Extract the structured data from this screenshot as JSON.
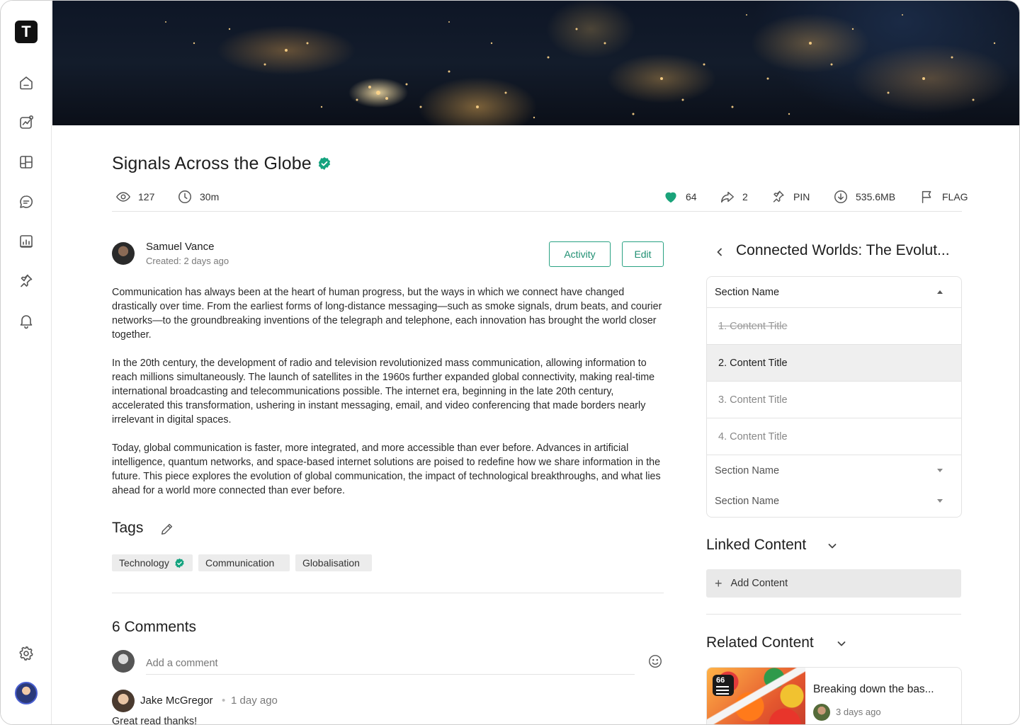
{
  "app": {
    "logo_letter": "T"
  },
  "sidebar": {
    "items": [
      {
        "icon": "home-icon"
      },
      {
        "icon": "analytics-icon"
      },
      {
        "icon": "layout-icon"
      },
      {
        "icon": "chat-icon"
      },
      {
        "icon": "report-icon"
      },
      {
        "icon": "pin-icon"
      },
      {
        "icon": "bell-icon"
      }
    ],
    "settings_icon": "gear-icon"
  },
  "article": {
    "title": "Signals Across the Globe",
    "stats": {
      "views": "127",
      "duration": "30m",
      "likes": "64",
      "shares": "2",
      "pin_label": "PIN",
      "size": "535.6MB",
      "flag_label": "FLAG"
    },
    "author": {
      "name": "Samuel Vance",
      "created": "Created: 2 days ago"
    },
    "buttons": {
      "activity": "Activity",
      "edit": "Edit"
    },
    "paragraphs": [
      "Communication has always been at the heart of human progress, but the ways in which we connect have changed drastically over time. From the earliest forms of long-distance messaging—such as smoke signals, drum beats, and courier networks—to the groundbreaking inventions of the telegraph and telephone, each innovation has brought the world closer together.",
      "In the 20th century, the development of radio and television revolutionized mass communication, allowing information to reach millions simultaneously. The launch of satellites in the 1960s further expanded global connectivity, making real-time international broadcasting and telecommunications possible. The internet era, beginning in the late 20th century, accelerated this transformation, ushering in instant messaging, email, and video conferencing that made borders nearly irrelevant in digital spaces.",
      "Today, global communication is faster, more integrated, and more accessible than ever before. Advances in artificial intelligence, quantum networks, and space-based internet solutions are poised to redefine how we share information in the future. This piece explores the evolution of global communication, the impact of technological breakthroughs, and what lies ahead for a world more connected than ever before."
    ],
    "tags_title": "Tags",
    "tags": [
      "Technology",
      "Communication",
      "Globalisation"
    ]
  },
  "comments": {
    "title": "6 Comments",
    "input_placeholder": "Add a comment",
    "items": [
      {
        "name": "Jake McGregor",
        "separator": "•",
        "time": "1 day ago",
        "text": "Great read thanks!"
      }
    ]
  },
  "right_panel": {
    "title": "Connected Worlds: The Evolut...",
    "sections": [
      {
        "name": "Section Name",
        "expanded": true,
        "items": [
          {
            "label": "1. Content Title",
            "state": "completed"
          },
          {
            "label": "2. Content Title",
            "state": "active"
          },
          {
            "label": "3. Content Title",
            "state": "default"
          },
          {
            "label": "4. Content Title",
            "state": "default"
          }
        ]
      },
      {
        "name": "Section Name",
        "expanded": false
      },
      {
        "name": "Section Name",
        "expanded": false
      }
    ],
    "linked_title": "Linked Content",
    "add_content_label": "Add Content",
    "related_title": "Related Content",
    "related": [
      {
        "title": "Breaking down the bas...",
        "time": "3 days ago",
        "badge": "66"
      }
    ]
  },
  "colors": {
    "accent": "#1f8f72",
    "verified": "#14a37f",
    "heart": "#1aa37a"
  }
}
